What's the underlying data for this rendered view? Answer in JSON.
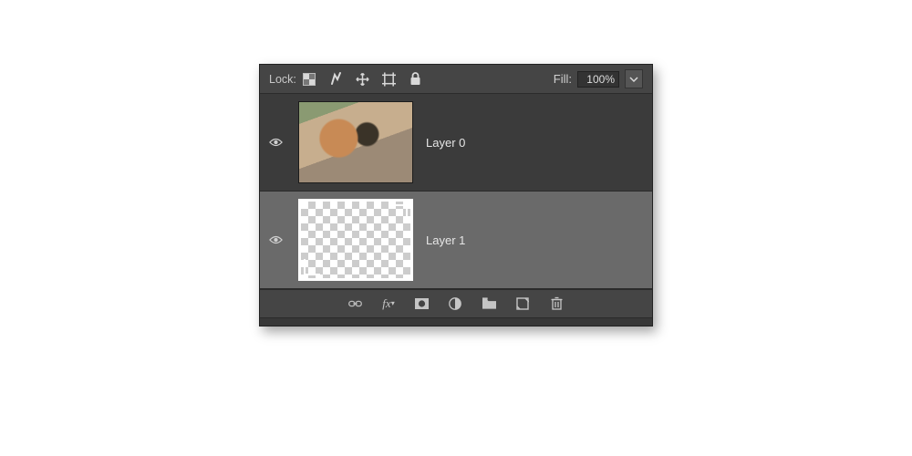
{
  "lock": {
    "label": "Lock:"
  },
  "fill": {
    "label": "Fill:",
    "value": "100%"
  },
  "layers": [
    {
      "name": "Layer 0",
      "selected": false,
      "visible": true,
      "kind": "photo"
    },
    {
      "name": "Layer 1",
      "selected": true,
      "visible": true,
      "kind": "checker-crop"
    }
  ],
  "icons": {
    "lock_transparent": "lock-transparent-icon",
    "lock_pixels": "lock-pixels-icon",
    "lock_position": "lock-position-icon",
    "lock_artboard": "lock-artboard-icon",
    "lock_all": "lock-all-icon",
    "link": "link-icon",
    "fx": "fx-icon",
    "mask": "mask-icon",
    "adjust": "adjust-icon",
    "group": "group-icon",
    "new": "new-layer-icon",
    "trash": "trash-icon"
  }
}
